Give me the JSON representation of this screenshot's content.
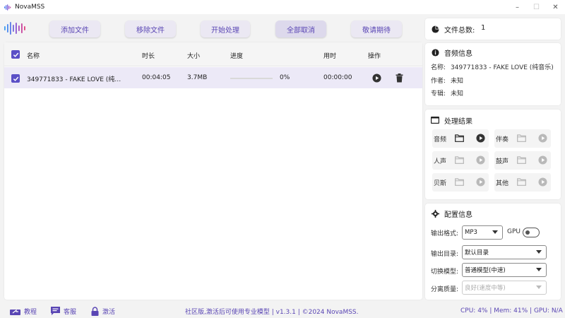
{
  "window": {
    "title": "NovaMSS",
    "controls": [
      "minimize",
      "maximize",
      "close"
    ]
  },
  "toolbar": {
    "add_files": "添加文件",
    "remove_files": "移除文件",
    "start_processing": "开始处理",
    "cancel_all": "全部取消",
    "coming_soon": "敬请期待"
  },
  "table": {
    "headers": {
      "name": "名称",
      "duration": "时长",
      "size": "大小",
      "progress": "进度",
      "elapsed": "用时",
      "actions": "操作"
    },
    "rows": [
      {
        "checked": true,
        "name": "349771833 - FAKE LOVE (纯…",
        "duration": "00:04:05",
        "size": "3.7MB",
        "progress": 0,
        "progress_text": "0%",
        "elapsed": "00:00:00"
      }
    ]
  },
  "file_count": {
    "label": "文件总数:",
    "value": "1"
  },
  "audio_info": {
    "title": "音频信息",
    "name_label": "名称:",
    "name_value": "349771833 - FAKE LOVE (纯音乐)",
    "author_label": "作者:",
    "author_value": "未知",
    "album_label": "专辑:",
    "album_value": "未知"
  },
  "results": {
    "title": "处理结果",
    "items": [
      {
        "label": "音频",
        "enabled": true
      },
      {
        "label": "伴奏",
        "enabled": false
      },
      {
        "label": "人声",
        "enabled": false
      },
      {
        "label": "鼓声",
        "enabled": false
      },
      {
        "label": "贝斯",
        "enabled": false
      },
      {
        "label": "其他",
        "enabled": false
      }
    ]
  },
  "config": {
    "title": "配置信息",
    "format_label": "输出格式:",
    "format_value": "MP3",
    "gpu_label": "GPU",
    "gpu_enabled": false,
    "outdir_label": "输出目录:",
    "outdir_value": "默认目录",
    "model_label": "切换模型:",
    "model_value": "普通模型(中速)",
    "quality_label": "分离质量:",
    "quality_value": "良好(速度中等)"
  },
  "statusbar": {
    "tutorial": "教程",
    "support": "客服",
    "activate": "激活",
    "center_text": "社区版,激活后可使用专业模型 | v1.3.1 | ©2024 NovaMSS.",
    "stats": "CPU: 4% | Mem: 41% | GPU: N/A"
  },
  "colors": {
    "accent": "#5b4fc6",
    "accent_text": "#5a46b4",
    "button_bg": "#ebe8f3",
    "selected_row": "#ece9f7"
  }
}
